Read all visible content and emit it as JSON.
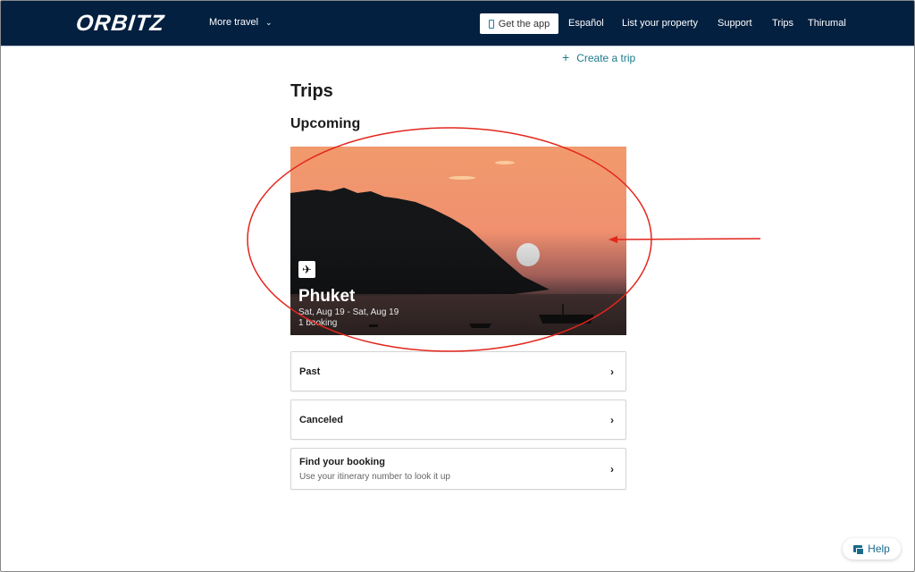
{
  "header": {
    "logo": "ORBITZ",
    "more_travel": "More travel",
    "get_app": "Get the app",
    "language": "Español",
    "list_property": "List your property",
    "support": "Support",
    "trips": "Trips",
    "user": "Thirumal"
  },
  "main": {
    "create_trip": "Create a trip",
    "title": "Trips",
    "upcoming_heading": "Upcoming",
    "upcoming_trip": {
      "destination": "Phuket",
      "dates": "Sat, Aug 19 - Sat, Aug 19",
      "bookings": "1 booking",
      "icon": "plane-icon"
    },
    "list": [
      {
        "label": "Past"
      },
      {
        "label": "Canceled"
      },
      {
        "label": "Find your booking",
        "sub": "Use your itinerary number to look it up"
      }
    ]
  },
  "help": {
    "label": "Help"
  },
  "colors": {
    "header_bg": "#032040",
    "link": "#1a7a8c",
    "annotation": "#e3261c"
  }
}
